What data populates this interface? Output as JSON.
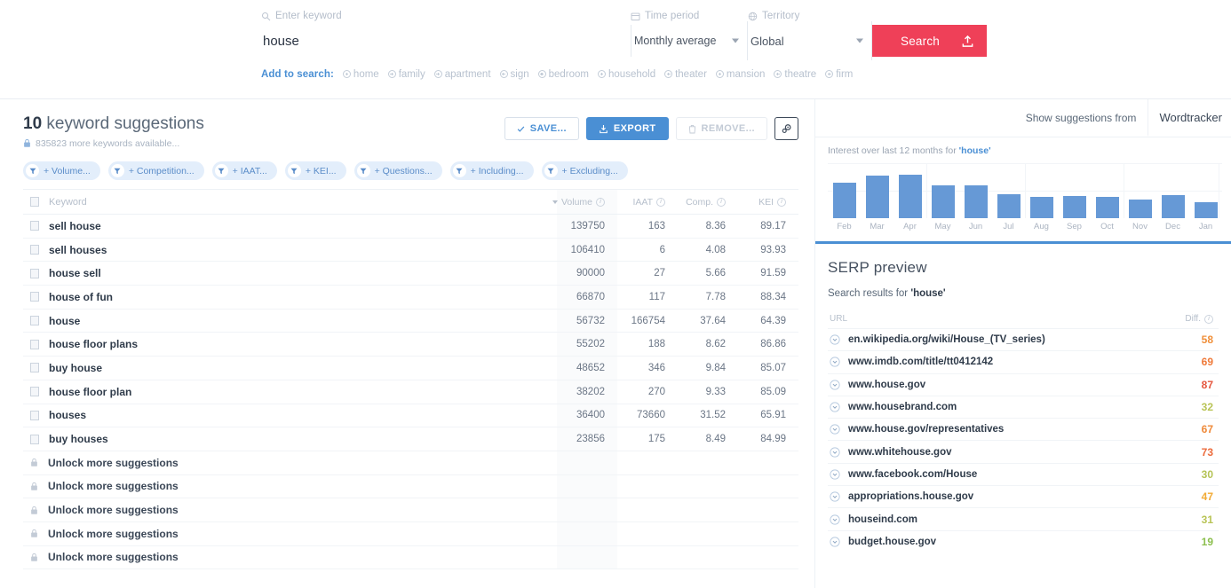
{
  "search": {
    "keyword_label": "Enter keyword",
    "keyword_value": "house",
    "keyword_placeholder": "Enter keyword",
    "time_period_label": "Time period",
    "time_period_value": "Monthly average",
    "territory_label": "Territory",
    "territory_value": "Global",
    "search_button": "Search",
    "add_to_search_label": "Add to search:",
    "add_terms": [
      "home",
      "family",
      "apartment",
      "sign",
      "bedroom",
      "household",
      "theater",
      "mansion",
      "theatre",
      "firm"
    ]
  },
  "results": {
    "count": "10",
    "title_rest": " keyword suggestions",
    "more_available": "835823 more keywords available...",
    "toolbar": {
      "save": "SAVE...",
      "export": "EXPORT",
      "remove": "REMOVE..."
    },
    "filters": [
      "+ Volume...",
      "+ Competition...",
      "+ IAAT...",
      "+ KEI...",
      "+ Questions...",
      "+ Including...",
      "+ Excluding..."
    ],
    "columns": {
      "keyword": "Keyword",
      "volume": "Volume",
      "iaat": "IAAT",
      "comp": "Comp.",
      "kei": "KEI"
    },
    "rows": [
      {
        "keyword": "sell house",
        "volume": "139750",
        "iaat": "163",
        "comp": "8.36",
        "kei": "89.17"
      },
      {
        "keyword": "sell houses",
        "volume": "106410",
        "iaat": "6",
        "comp": "4.08",
        "kei": "93.93"
      },
      {
        "keyword": "house sell",
        "volume": "90000",
        "iaat": "27",
        "comp": "5.66",
        "kei": "91.59"
      },
      {
        "keyword": "house of fun",
        "volume": "66870",
        "iaat": "117",
        "comp": "7.78",
        "kei": "88.34"
      },
      {
        "keyword": "house",
        "volume": "56732",
        "iaat": "166754",
        "comp": "37.64",
        "kei": "64.39"
      },
      {
        "keyword": "house floor plans",
        "volume": "55202",
        "iaat": "188",
        "comp": "8.62",
        "kei": "86.86"
      },
      {
        "keyword": "buy house",
        "volume": "48652",
        "iaat": "346",
        "comp": "9.84",
        "kei": "85.07"
      },
      {
        "keyword": "house floor plan",
        "volume": "38202",
        "iaat": "270",
        "comp": "9.33",
        "kei": "85.09"
      },
      {
        "keyword": "houses",
        "volume": "36400",
        "iaat": "73660",
        "comp": "31.52",
        "kei": "65.91"
      },
      {
        "keyword": "buy houses",
        "volume": "23856",
        "iaat": "175",
        "comp": "8.49",
        "kei": "84.99"
      }
    ],
    "locked_label": "Unlock more suggestions",
    "locked_count": 5
  },
  "right_panel": {
    "suggestions_from_label": "Show suggestions from",
    "suggestions_source": "Wordtracker",
    "serp": {
      "heading": "SERP preview",
      "subtitle_prefix": "Search results for ",
      "subtitle_keyword": "'house'",
      "col_url": "URL",
      "col_diff": "Diff.",
      "rows": [
        {
          "url": "en.wikipedia.org/wiki/House_(TV_series)",
          "diff": "58",
          "color": "#f0903b"
        },
        {
          "url": "www.imdb.com/title/tt0412142",
          "diff": "69",
          "color": "#ef7a3a"
        },
        {
          "url": "www.house.gov",
          "diff": "87",
          "color": "#e5573f"
        },
        {
          "url": "www.housebrand.com",
          "diff": "32",
          "color": "#b8c council"
        },
        {
          "url": "www.house.gov/representatives",
          "diff": "67",
          "color": "#ef8a3a"
        },
        {
          "url": "www.whitehouse.gov",
          "diff": "73",
          "color": "#ec6b3c"
        },
        {
          "url": "www.facebook.com/House",
          "diff": "30",
          "color": "#b5c356"
        },
        {
          "url": "appropriations.house.gov",
          "diff": "47",
          "color": "#f2ab36"
        },
        {
          "url": "houseind.com",
          "diff": "31",
          "color": "#b9c457"
        },
        {
          "url": "budget.house.gov",
          "diff": "19",
          "color": "#8cbf4e"
        }
      ]
    }
  },
  "chart_data": {
    "type": "bar",
    "title": "Interest over last 12 months for ",
    "title_keyword": "'house'",
    "categories": [
      "Feb",
      "Mar",
      "Apr",
      "May",
      "Jun",
      "Jul",
      "Aug",
      "Sep",
      "Oct",
      "Nov",
      "Dec",
      "Jan"
    ],
    "values": [
      72,
      85,
      88,
      66,
      66,
      48,
      43,
      44,
      42,
      38,
      47,
      33
    ],
    "xlabel": "",
    "ylabel": "",
    "ylim": [
      0,
      100
    ],
    "grid": true,
    "legend": "none",
    "bar_color": "#6699d6"
  }
}
